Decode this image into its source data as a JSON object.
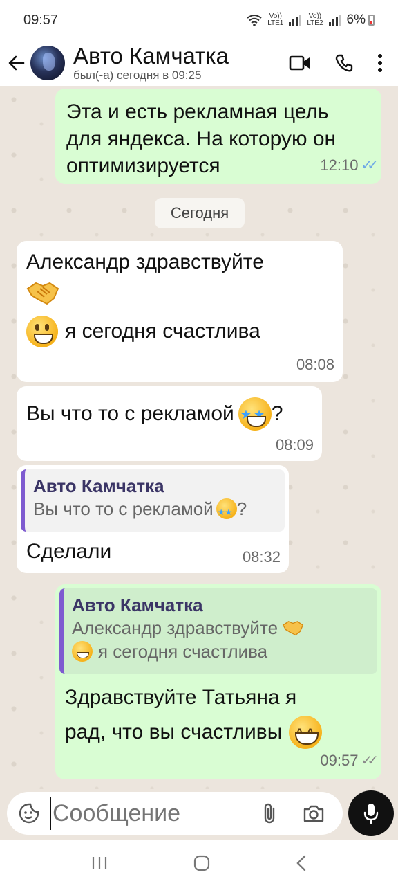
{
  "status_bar": {
    "time": "09:57",
    "sim1": "Vo))\nLTE1",
    "sim2": "Vo))\nLTE2",
    "battery": "6%"
  },
  "header": {
    "contact_name": "Авто Камчатка",
    "last_seen": "был(-а) сегодня в 09:25"
  },
  "messages": [
    {
      "direction": "out",
      "text": "Эта и есть рекламная цель для яндекса. На которую он оптимизируется",
      "time": "12:10",
      "status": "read"
    },
    {
      "direction": "in",
      "text_line1": "Александр здравствуйте",
      "emoji_handshake": "handshake-emoji",
      "text_line3": "я сегодня счастлива",
      "time": "08:08"
    },
    {
      "direction": "in",
      "text": "Вы что то с рекламой",
      "suffix": "?",
      "time": "08:09"
    },
    {
      "direction": "in",
      "quote_name": "Авто Камчатка",
      "quote_text": "Вы что то с рекламой",
      "quote_suffix": "?",
      "text": "Сделали",
      "time": "08:32"
    },
    {
      "direction": "out",
      "quote_name": "Авто Камчатка",
      "quote_line1": "Александр здравствуйте",
      "quote_line2": "я сегодня счастлива",
      "text_line1": "Здравствуйте Татьяна я",
      "text_line2": "рад, что вы счастливы",
      "time": "09:57",
      "status": "delivered"
    }
  ],
  "date_divider": "Сегодня",
  "composer": {
    "placeholder": "Сообщение"
  },
  "colors": {
    "outgoing_bubble": "#d9fdd3",
    "incoming_bubble": "#ffffff",
    "quote_bar": "#7e5bd0",
    "read_ticks": "#6ea8e6"
  }
}
